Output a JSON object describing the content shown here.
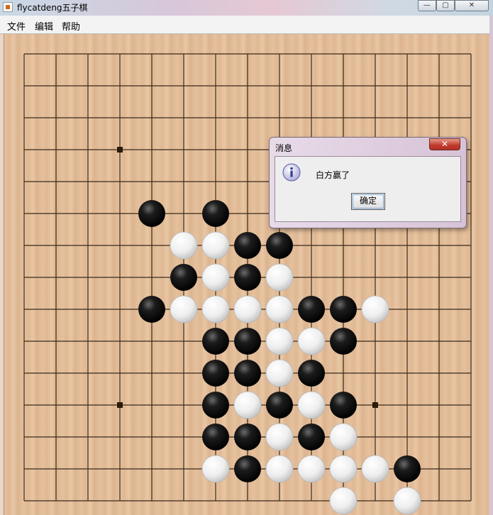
{
  "window": {
    "title": "flycatdeng五子棋",
    "min_glyph": "—",
    "max_glyph": "▢",
    "close_glyph": "✕"
  },
  "menubar": {
    "items": [
      "文件",
      "编辑",
      "帮助"
    ]
  },
  "board": {
    "size": 15,
    "star_points": [
      [
        3,
        3
      ],
      [
        11,
        3
      ],
      [
        3,
        11
      ],
      [
        11,
        11
      ]
    ],
    "colors": {
      "line": "#3a2a1a",
      "black": "#111111",
      "white": "#f2f2f2"
    },
    "stones": [
      {
        "c": 4,
        "r": 5,
        "color": "black"
      },
      {
        "c": 6,
        "r": 5,
        "color": "black"
      },
      {
        "c": 5,
        "r": 6,
        "color": "white"
      },
      {
        "c": 6,
        "r": 6,
        "color": "white"
      },
      {
        "c": 7,
        "r": 6,
        "color": "black"
      },
      {
        "c": 8,
        "r": 6,
        "color": "black"
      },
      {
        "c": 5,
        "r": 7,
        "color": "black"
      },
      {
        "c": 6,
        "r": 7,
        "color": "white"
      },
      {
        "c": 7,
        "r": 7,
        "color": "black"
      },
      {
        "c": 8,
        "r": 7,
        "color": "white"
      },
      {
        "c": 4,
        "r": 8,
        "color": "black"
      },
      {
        "c": 5,
        "r": 8,
        "color": "white"
      },
      {
        "c": 6,
        "r": 8,
        "color": "white"
      },
      {
        "c": 7,
        "r": 8,
        "color": "white"
      },
      {
        "c": 8,
        "r": 8,
        "color": "white"
      },
      {
        "c": 9,
        "r": 8,
        "color": "black"
      },
      {
        "c": 10,
        "r": 8,
        "color": "black"
      },
      {
        "c": 11,
        "r": 8,
        "color": "white"
      },
      {
        "c": 6,
        "r": 9,
        "color": "black"
      },
      {
        "c": 7,
        "r": 9,
        "color": "black"
      },
      {
        "c": 8,
        "r": 9,
        "color": "white"
      },
      {
        "c": 9,
        "r": 9,
        "color": "white"
      },
      {
        "c": 10,
        "r": 9,
        "color": "black"
      },
      {
        "c": 6,
        "r": 10,
        "color": "black"
      },
      {
        "c": 7,
        "r": 10,
        "color": "black"
      },
      {
        "c": 8,
        "r": 10,
        "color": "white"
      },
      {
        "c": 9,
        "r": 10,
        "color": "black"
      },
      {
        "c": 6,
        "r": 11,
        "color": "black"
      },
      {
        "c": 7,
        "r": 11,
        "color": "white"
      },
      {
        "c": 8,
        "r": 11,
        "color": "black"
      },
      {
        "c": 9,
        "r": 11,
        "color": "white"
      },
      {
        "c": 10,
        "r": 11,
        "color": "black"
      },
      {
        "c": 6,
        "r": 12,
        "color": "black"
      },
      {
        "c": 7,
        "r": 12,
        "color": "black"
      },
      {
        "c": 8,
        "r": 12,
        "color": "white"
      },
      {
        "c": 9,
        "r": 12,
        "color": "black"
      },
      {
        "c": 10,
        "r": 12,
        "color": "white"
      },
      {
        "c": 6,
        "r": 13,
        "color": "white"
      },
      {
        "c": 7,
        "r": 13,
        "color": "black"
      },
      {
        "c": 8,
        "r": 13,
        "color": "white"
      },
      {
        "c": 9,
        "r": 13,
        "color": "white"
      },
      {
        "c": 10,
        "r": 13,
        "color": "white"
      },
      {
        "c": 11,
        "r": 13,
        "color": "white"
      },
      {
        "c": 12,
        "r": 13,
        "color": "black"
      },
      {
        "c": 10,
        "r": 14,
        "color": "white"
      },
      {
        "c": 12,
        "r": 14,
        "color": "white"
      }
    ]
  },
  "dialog": {
    "title": "消息",
    "close_glyph": "✕",
    "icon": "info-icon",
    "message": "白方赢了",
    "ok_label": "确定"
  }
}
